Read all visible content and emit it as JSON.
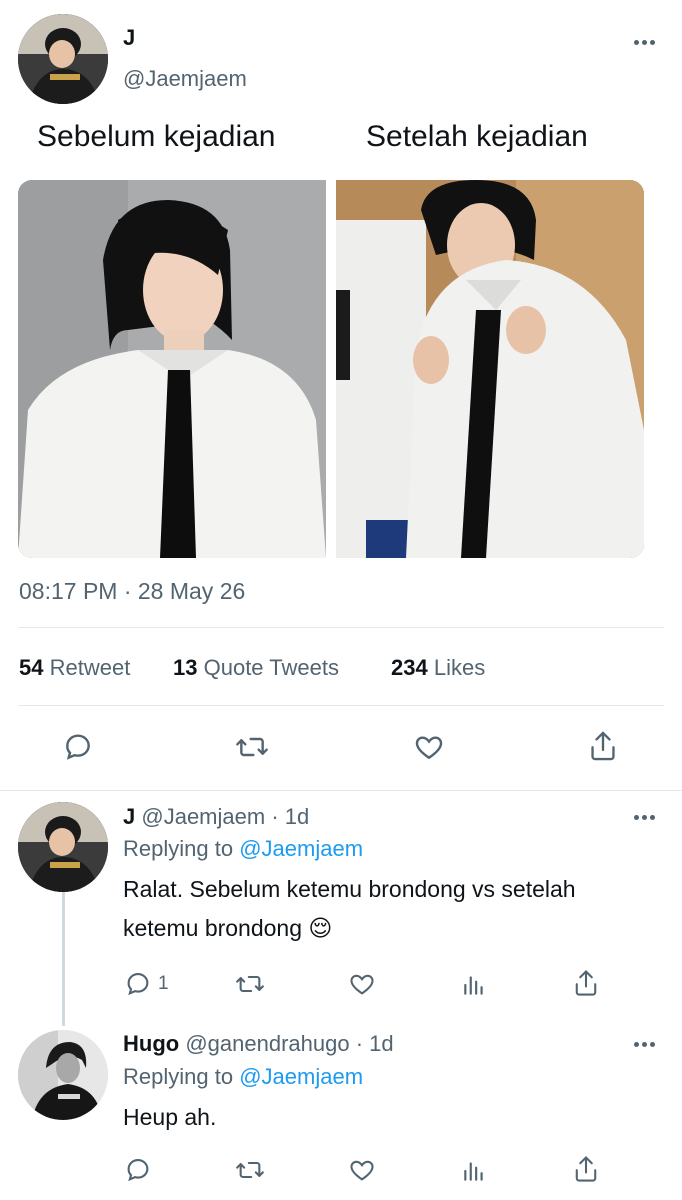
{
  "main_tweet": {
    "author_name": "J",
    "author_handle": "@Jaemjaem",
    "caption_left": "Sebelum kejadian",
    "caption_right": "Setelah kejadian",
    "timestamp": "08:17 PM · 28 May 26",
    "stats": {
      "retweets_count": "54",
      "retweets_label": "Retweet",
      "quotes_count": "13",
      "quotes_label": "Quote Tweets",
      "likes_count": "234",
      "likes_label": "Likes"
    }
  },
  "replies": [
    {
      "author_name": "J",
      "author_handle": "@Jaemjaem",
      "time": "· 1d",
      "replying_prefix": "Replying to",
      "replying_handle": "@Jaemjaem",
      "text_line1": "Ralat. Sebelum ketemu brondong vs setelah",
      "text_line2": "ketemu brondong 😌",
      "reply_count": "1"
    },
    {
      "author_name": "Hugo",
      "author_handle": "@ganendrahugo",
      "time": "· 1d",
      "replying_prefix": "Replying to",
      "replying_handle": "@Jaemjaem",
      "text_line1": "Heup ah."
    }
  ],
  "icons": {
    "more": "more-horizontal-icon",
    "reply": "reply-bubble-icon",
    "retweet": "retweet-icon",
    "like": "heart-icon",
    "share": "share-upload-icon",
    "analytics": "analytics-bars-icon"
  },
  "colors": {
    "link": "#1d9bf0",
    "text": "#0f1419",
    "muted": "#536471"
  }
}
